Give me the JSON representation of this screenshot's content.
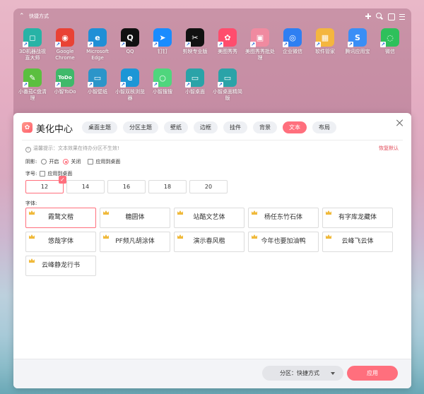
{
  "desktop": {
    "fence_title": "快捷方式",
    "shortcuts": [
      {
        "label": "3D机器战视\n直大师",
        "icon": "game-icon",
        "color": "#27b3a6",
        "glyph": "◻"
      },
      {
        "label": "Google\nChrome",
        "icon": "chrome-icon",
        "color": "#e94235",
        "glyph": "◉"
      },
      {
        "label": "Microsoft\nEdge",
        "icon": "edge-icon",
        "color": "#1f8fd6",
        "glyph": "e"
      },
      {
        "label": "QQ",
        "icon": "qq-icon",
        "color": "#111111",
        "glyph": "Q"
      },
      {
        "label": "钉钉",
        "icon": "dingtalk-icon",
        "color": "#1a8cff",
        "glyph": "➤"
      },
      {
        "label": "剪映专业版",
        "icon": "capcut-icon",
        "color": "#111111",
        "glyph": "✂"
      },
      {
        "label": "美图秀秀",
        "icon": "meitu-icon",
        "color": "#ff4d6d",
        "glyph": "✿"
      },
      {
        "label": "美图秀秀批处\n理",
        "icon": "meitu-batch-icon",
        "color": "#f08aa0",
        "glyph": "▣"
      },
      {
        "label": "企业微信",
        "icon": "wecom-icon",
        "color": "#2f7ff2",
        "glyph": "◎"
      },
      {
        "label": "软件管家",
        "icon": "softmgr-icon",
        "color": "#f4b63f",
        "glyph": "▦"
      },
      {
        "label": "腾讯应用宝",
        "icon": "appstore-icon",
        "color": "#3a8ef6",
        "glyph": "S"
      },
      {
        "label": "微信",
        "icon": "wechat-icon",
        "color": "#2ec05b",
        "glyph": "◌"
      },
      {
        "label": "小番茄C盘清\n理",
        "icon": "broom-icon",
        "color": "#5bbf3f",
        "glyph": "✎"
      },
      {
        "label": "小智ToDo",
        "icon": "todo-icon",
        "color": "#3fb96a",
        "glyph": "ToDo"
      },
      {
        "label": "小智壁纸",
        "icon": "wallpaper-icon",
        "color": "#2c95c9",
        "glyph": "▭"
      },
      {
        "label": "小智双核浏览\n器",
        "icon": "browser-icon",
        "color": "#1d96d6",
        "glyph": "e"
      },
      {
        "label": "小智搜搜",
        "icon": "search-app-icon",
        "color": "#4fd67d",
        "glyph": "○"
      },
      {
        "label": "小智桌面",
        "icon": "desktop-icon",
        "color": "#2aa3a8",
        "glyph": "▭"
      },
      {
        "label": "小智桌面精简\n版",
        "icon": "desktop-lite-icon",
        "color": "#2aa3a8",
        "glyph": "▭"
      }
    ]
  },
  "window": {
    "title": "美化中心",
    "tabs": [
      "桌面主题",
      "分区主题",
      "壁纸",
      "边框",
      "挂件",
      "背景",
      "文本",
      "布局"
    ],
    "active_tab": "文本",
    "tip": "温馨提示：文本效果在待办分区不生效!",
    "reset_label": "恢复默认",
    "shadow": {
      "label": "阴影:",
      "on_label": "开启",
      "off_label": "关闭",
      "apply_desktop_label": "应用到桌面",
      "selected": "关闭"
    },
    "font_size": {
      "label": "字号:",
      "apply_desktop_label": "应用到桌面",
      "options": [
        "12",
        "14",
        "16",
        "18",
        "20"
      ],
      "selected": "12"
    },
    "font": {
      "label": "字体:",
      "options": [
        "霞鹜文楷",
        "糖圆体",
        "站酷文艺体",
        "杨任东竹石体",
        "有字库龙藏体",
        "悠哉字体",
        "PF频凡胡涂体",
        "演示春风楷",
        "今年也要加油鸭",
        "云峰飞云体",
        "云峰静龙行书"
      ],
      "selected": "霞鹜文楷"
    },
    "footer": {
      "partition_label": "分区：快捷方式",
      "apply_label": "应用"
    }
  },
  "colors": {
    "accent": "#ff6f7d",
    "crown": "#f0b93a",
    "reset_link": "#e24c5a"
  }
}
